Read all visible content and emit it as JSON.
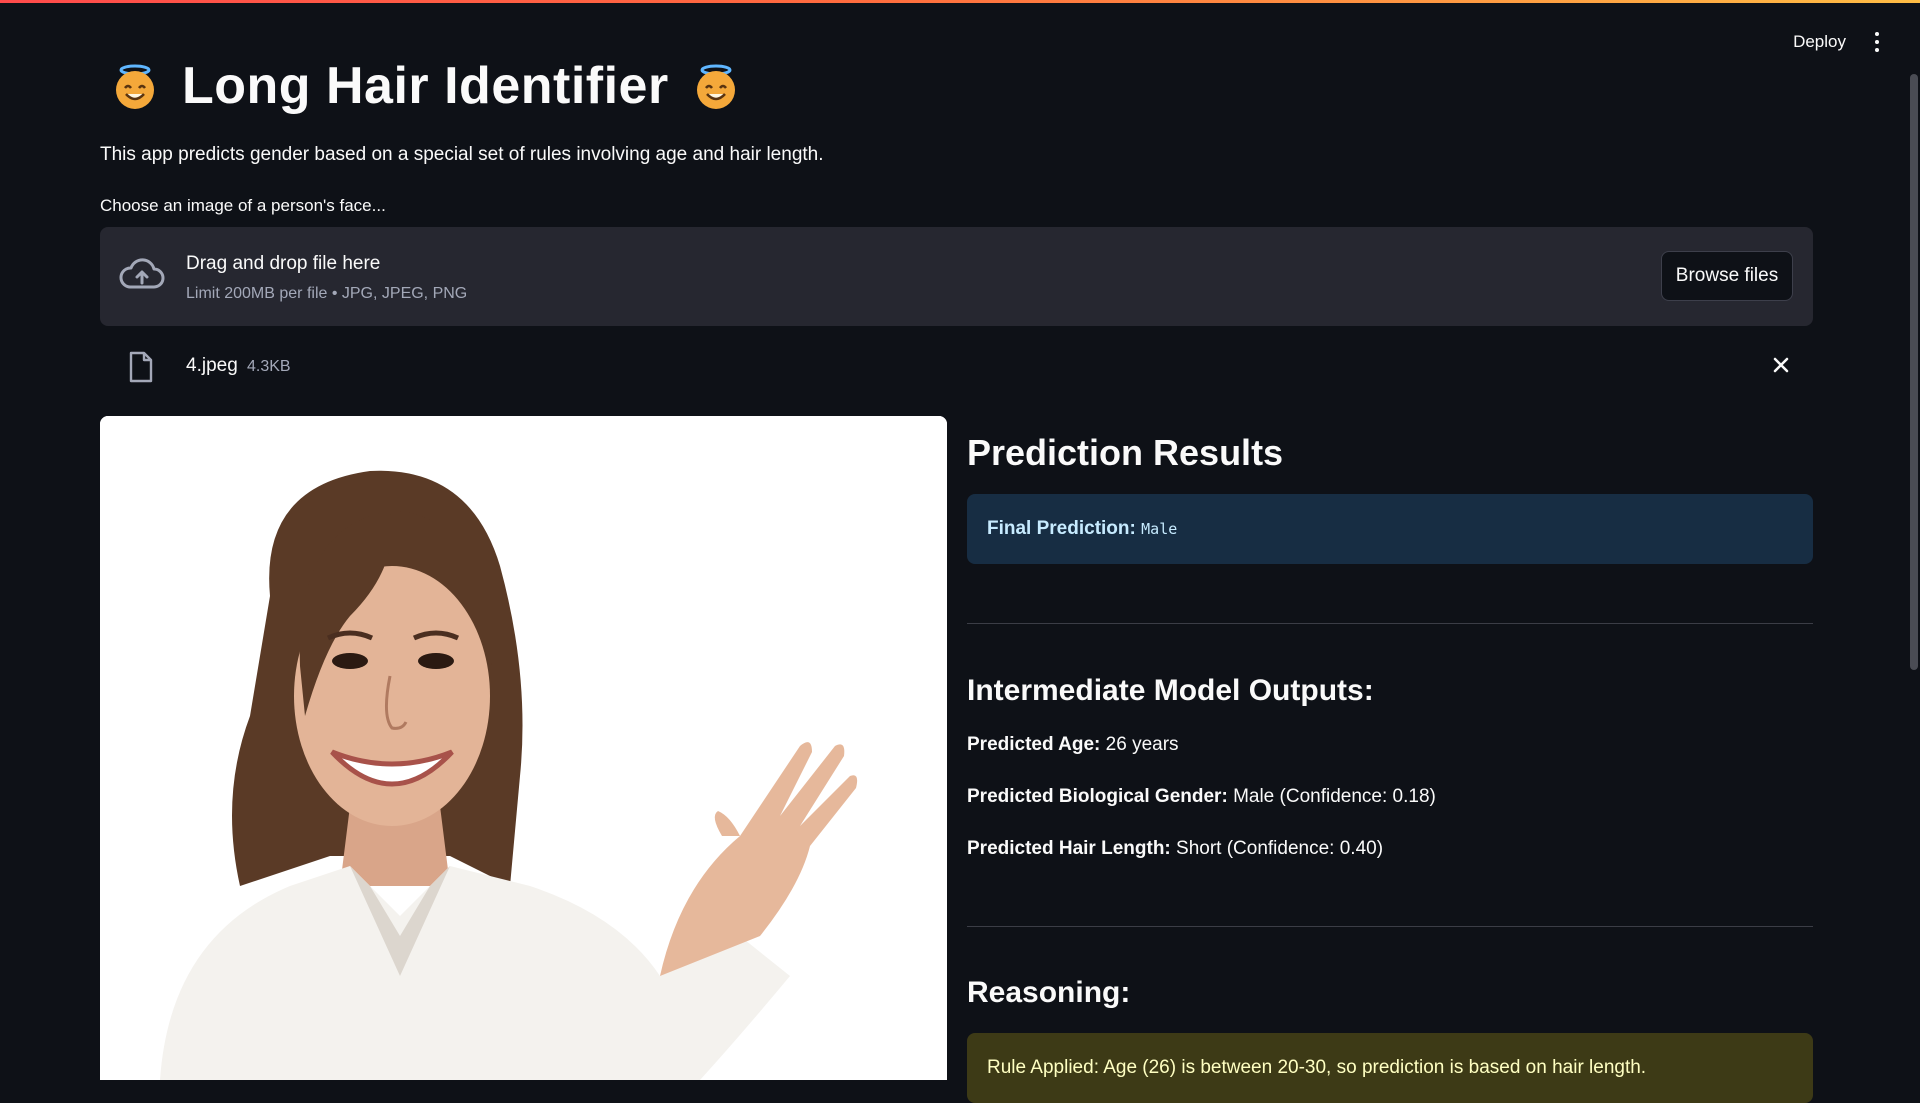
{
  "header": {
    "deploy_label": "Deploy",
    "menu_icon": "more-vertical-icon",
    "accent_gradient": [
      "#ff4b4b",
      "#ffbd45"
    ]
  },
  "app": {
    "title": "Long Hair Identifier",
    "title_emoji_icon": "smiling-face-with-halo-emoji",
    "subtitle": "This app predicts gender based on a special set of rules involving age and hair length."
  },
  "uploader": {
    "label": "Choose an image of a person's face...",
    "drop_text": "Drag and drop file here",
    "limit_text": "Limit 200MB per file • JPG, JPEG, PNG",
    "browse_label": "Browse files",
    "icon": "cloud-upload-icon"
  },
  "uploaded_file": {
    "name": "4.jpeg",
    "size": "4.3KB",
    "icon": "file-icon",
    "remove_icon": "close-icon"
  },
  "results": {
    "title": "Prediction Results",
    "final_label": "Final Prediction:",
    "final_value": "Male",
    "intermediate_title": "Intermediate Model Outputs:",
    "age_label": "Predicted Age:",
    "age_value": "26 years",
    "gender_label": "Predicted Biological Gender:",
    "gender_value": "Male (Confidence: 0.18)",
    "hair_label": "Predicted Hair Length:",
    "hair_value": "Short (Confidence: 0.40)",
    "reasoning_title": "Reasoning:",
    "rule_text": "Rule Applied: Age (26) is between 20-30, so prediction is based on hair length."
  },
  "colors": {
    "background": "#0e1117",
    "panel": "#262730",
    "info_bg": "#172d43",
    "warning_bg": "#3d3a16"
  }
}
